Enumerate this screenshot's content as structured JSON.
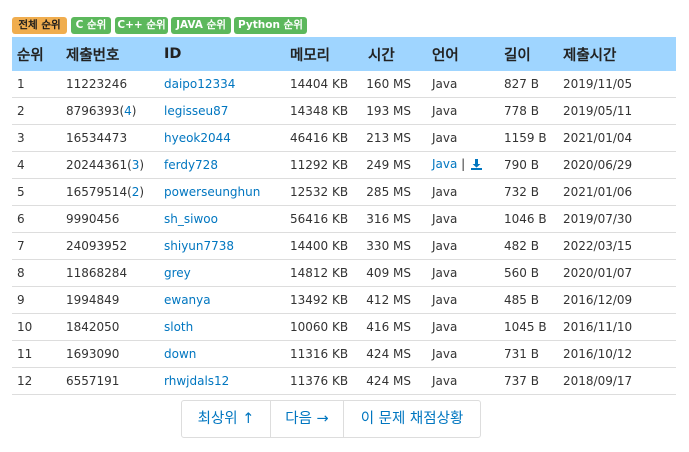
{
  "tabs": [
    {
      "label": "전체 순위",
      "active": true
    },
    {
      "label": "C 순위",
      "active": false
    },
    {
      "label": "C++ 순위",
      "active": false
    },
    {
      "label": "JAVA 순위",
      "active": false
    },
    {
      "label": "Python 순위",
      "active": false
    }
  ],
  "table": {
    "headers": [
      "순위",
      "제출번호",
      "ID",
      "메모리",
      "시간",
      "언어",
      "길이",
      "제출시간"
    ],
    "rows": [
      {
        "rank": "1",
        "submission": "11223246",
        "count": "",
        "id": "daipo12334",
        "memory": "14404 KB",
        "time": "160 MS",
        "language": "Java",
        "download": false,
        "length": "827 B",
        "submitted": "2019/11/05"
      },
      {
        "rank": "2",
        "submission": "8796393",
        "count": "4",
        "id": "legisseu87",
        "memory": "14348 KB",
        "time": "193 MS",
        "language": "Java",
        "download": false,
        "length": "778 B",
        "submitted": "2019/05/11"
      },
      {
        "rank": "3",
        "submission": "16534473",
        "count": "",
        "id": "hyeok2044",
        "memory": "46416 KB",
        "time": "213 MS",
        "language": "Java",
        "download": false,
        "length": "1159 B",
        "submitted": "2021/01/04"
      },
      {
        "rank": "4",
        "submission": "20244361",
        "count": "3",
        "id": "ferdy728",
        "memory": "11292 KB",
        "time": "249 MS",
        "language": "Java",
        "download": true,
        "length": "790 B",
        "submitted": "2020/06/29"
      },
      {
        "rank": "5",
        "submission": "16579514",
        "count": "2",
        "id": "powerseunghun",
        "memory": "12532 KB",
        "time": "285 MS",
        "language": "Java",
        "download": false,
        "length": "732 B",
        "submitted": "2021/01/06"
      },
      {
        "rank": "6",
        "submission": "9990456",
        "count": "",
        "id": "sh_siwoo",
        "memory": "56416 KB",
        "time": "316 MS",
        "language": "Java",
        "download": false,
        "length": "1046 B",
        "submitted": "2019/07/30"
      },
      {
        "rank": "7",
        "submission": "24093952",
        "count": "",
        "id": "shiyun7738",
        "memory": "14400 KB",
        "time": "330 MS",
        "language": "Java",
        "download": false,
        "length": "482 B",
        "submitted": "2022/03/15"
      },
      {
        "rank": "8",
        "submission": "11868284",
        "count": "",
        "id": "grey",
        "memory": "14812 KB",
        "time": "409 MS",
        "language": "Java",
        "download": false,
        "length": "560 B",
        "submitted": "2020/01/07"
      },
      {
        "rank": "9",
        "submission": "1994849",
        "count": "",
        "id": "ewanya",
        "memory": "13492 KB",
        "time": "412 MS",
        "language": "Java",
        "download": false,
        "length": "485 B",
        "submitted": "2016/12/09"
      },
      {
        "rank": "10",
        "submission": "1842050",
        "count": "",
        "id": "sloth",
        "memory": "10060 KB",
        "time": "416 MS",
        "language": "Java",
        "download": false,
        "length": "1045 B",
        "submitted": "2016/11/10"
      },
      {
        "rank": "11",
        "submission": "1693090",
        "count": "",
        "id": "down",
        "memory": "11316 KB",
        "time": "424 MS",
        "language": "Java",
        "download": false,
        "length": "731 B",
        "submitted": "2016/10/12"
      },
      {
        "rank": "12",
        "submission": "6557191",
        "count": "",
        "id": "rhwjdals12",
        "memory": "11376 KB",
        "time": "424 MS",
        "language": "Java",
        "download": false,
        "length": "737 B",
        "submitted": "2018/09/17"
      }
    ]
  },
  "pager": {
    "top": "최상위 ↑",
    "next": "다음 →",
    "status": "이 문제 채점상황"
  },
  "colors": {
    "active_tab": "#f0ad4e",
    "tab": "#5cb85c",
    "header_row": "#9fd5ff",
    "link": "#0076c0"
  },
  "icons": {
    "download": "download-icon"
  }
}
